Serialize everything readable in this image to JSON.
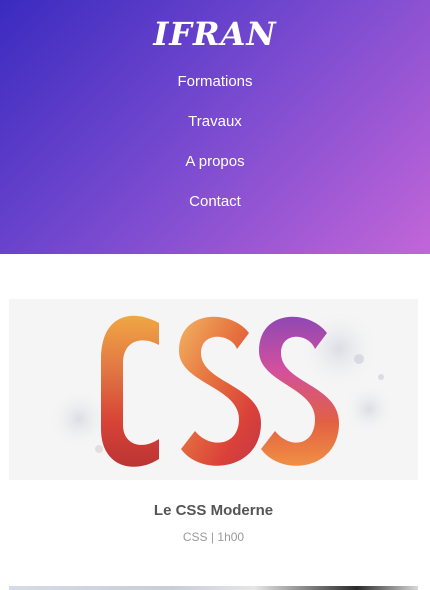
{
  "header": {
    "logo": "IFRAN",
    "nav": [
      {
        "label": "Formations"
      },
      {
        "label": "Travaux"
      },
      {
        "label": "A propos"
      },
      {
        "label": "Contact"
      }
    ]
  },
  "courses": [
    {
      "title": "Le CSS Moderne",
      "category": "CSS",
      "separator": "|",
      "duration": "1h00",
      "image_text": "CSS"
    }
  ]
}
